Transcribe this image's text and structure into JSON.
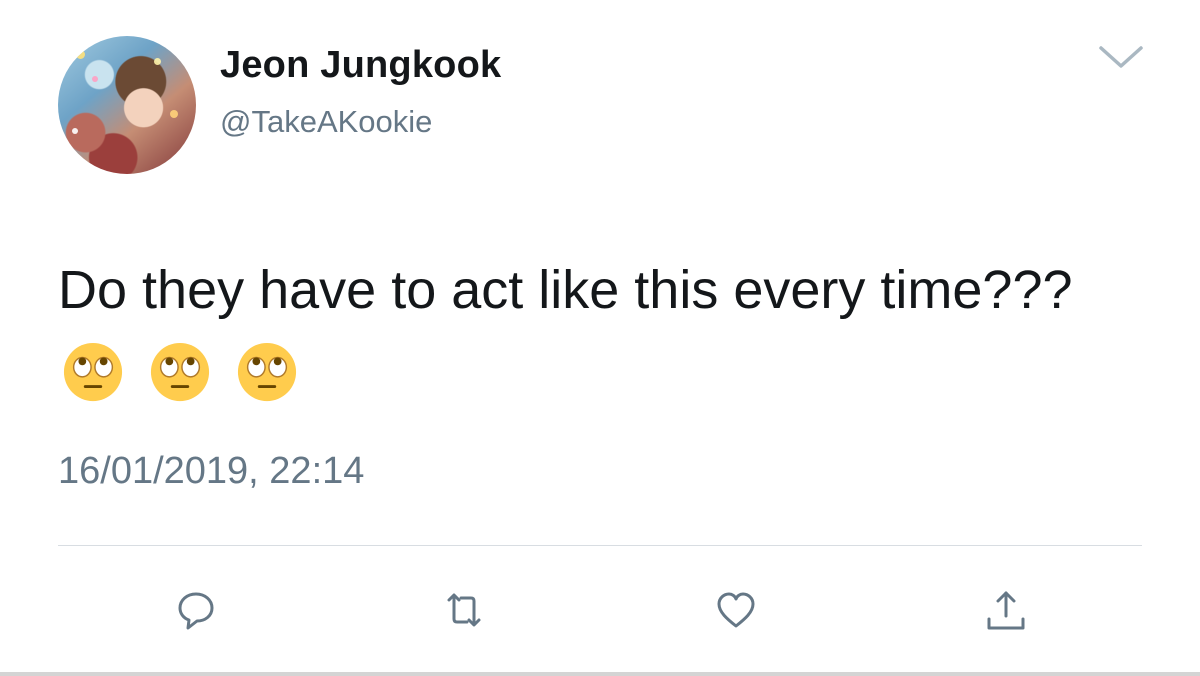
{
  "user": {
    "display_name": "Jeon Jungkook",
    "handle": "@TakeAKookie"
  },
  "tweet": {
    "text": "Do they have to act like this every time???",
    "emojis": [
      "face-with-rolling-eyes",
      "face-with-rolling-eyes",
      "face-with-rolling-eyes"
    ],
    "timestamp": "16/01/2019, 22:14"
  },
  "actions": [
    "reply",
    "retweet",
    "like",
    "share"
  ],
  "colors": {
    "text_primary": "#14171a",
    "text_secondary": "#657786",
    "icon": "#657786",
    "divider": "#d8dde2",
    "emoji_face": "#ffcc4d"
  },
  "icons": {
    "menu": "chevron-down-icon",
    "reply": "speech-bubble-icon",
    "retweet": "retweet-arrows-icon",
    "like": "heart-icon",
    "share": "share-arrow-icon"
  }
}
